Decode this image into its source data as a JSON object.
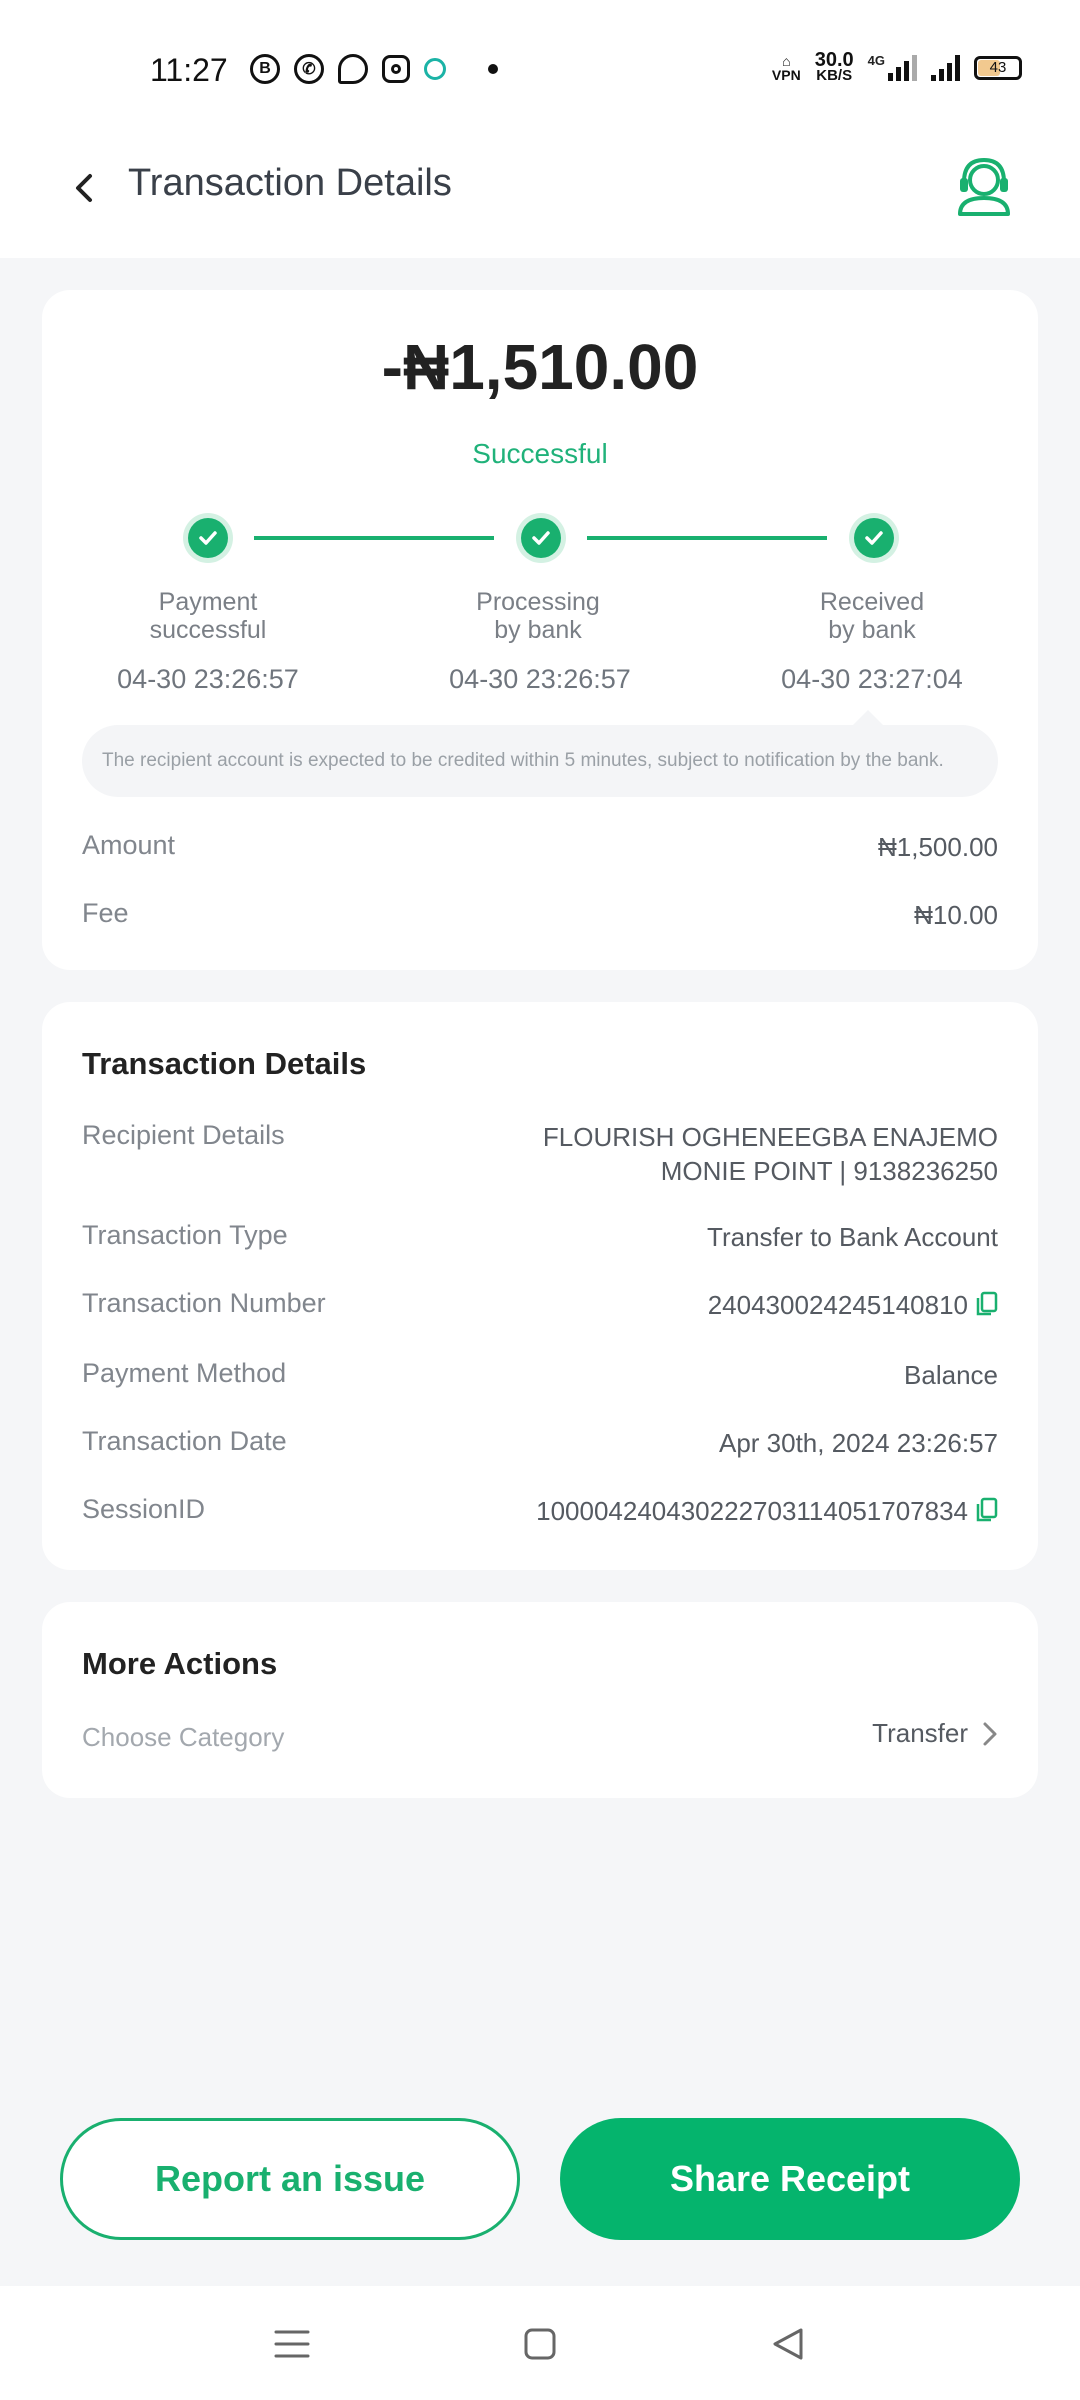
{
  "status_bar": {
    "time": "11:27",
    "vpn": "VPN",
    "speed_value": "30.0",
    "speed_unit": "KB/S",
    "network": "4G",
    "battery": "43"
  },
  "header": {
    "title": "Transaction Details",
    "back_icon": "chevron-left-icon",
    "support_icon": "customer-support-icon"
  },
  "summary": {
    "amount": "-₦1,510.00",
    "status": "Successful",
    "steps": [
      {
        "label_line1": "Payment",
        "label_line2": "successful",
        "time": "04-30 23:26:57"
      },
      {
        "label_line1": "Processing",
        "label_line2": "by bank",
        "time": "04-30 23:26:57"
      },
      {
        "label_line1": "Received",
        "label_line2": "by bank",
        "time": "04-30 23:27:04"
      }
    ],
    "notice": "The recipient account is expected to be credited within 5 minutes, subject to notification by the bank.",
    "rows": [
      {
        "label": "Amount",
        "value": "₦1,500.00"
      },
      {
        "label": "Fee",
        "value": "₦10.00"
      }
    ]
  },
  "details": {
    "title": "Transaction Details",
    "recipient_label": "Recipient Details",
    "recipient_name": "FLOURISH OGHENEEGBA ENAJEMO",
    "recipient_bank": "MONIE POINT | 9138236250",
    "type_label": "Transaction Type",
    "type_value": "Transfer to Bank Account",
    "number_label": "Transaction Number",
    "number_value": "240430024245140810",
    "method_label": "Payment Method",
    "method_value": "Balance",
    "date_label": "Transaction Date",
    "date_value": "Apr 30th, 2024 23:26:57",
    "session_label": "SessionID",
    "session_value": "100004240430222703114051707834"
  },
  "more_actions": {
    "title": "More Actions",
    "category_label": "Choose Category",
    "category_value": "Transfer"
  },
  "buttons": {
    "report": "Report an issue",
    "share": "Share Receipt"
  },
  "colors": {
    "accent": "#19b06f",
    "button_fill": "#05b46d",
    "background": "#f5f6f8"
  }
}
